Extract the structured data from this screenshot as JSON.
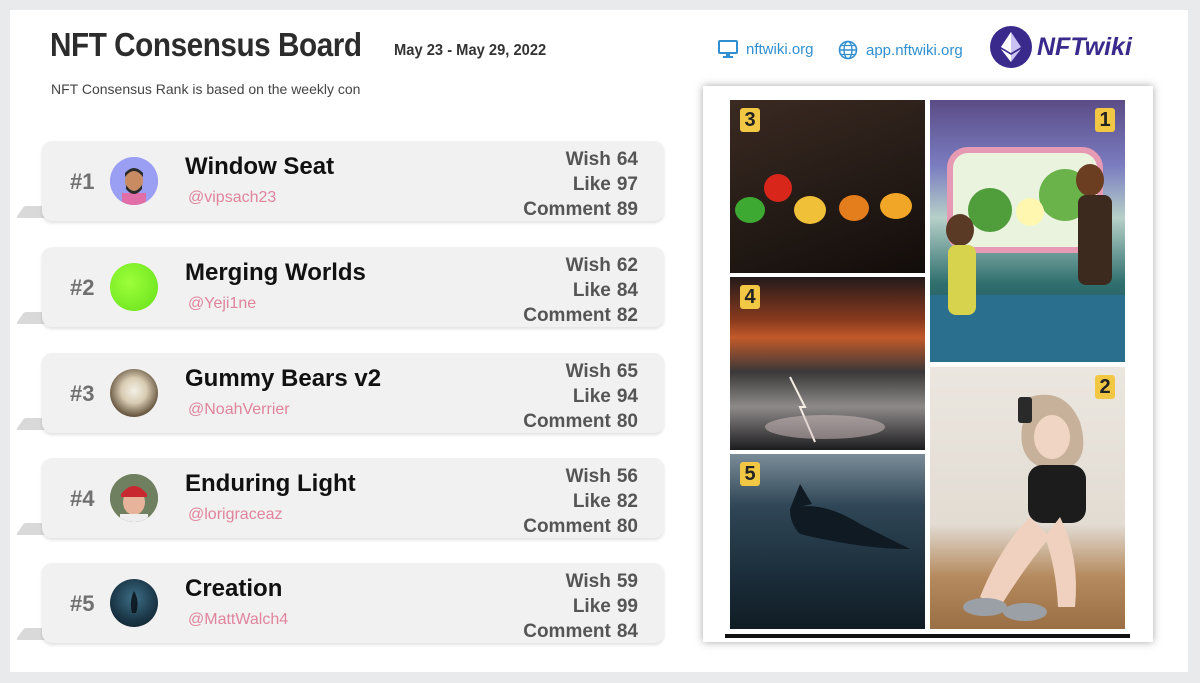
{
  "header": {
    "title": "NFT Consensus Board",
    "date_range": "May 23  - May 29, 2022",
    "subtitle": "NFT Consensus Rank is based on the weekly con",
    "links": [
      {
        "label": "nftwiki.org",
        "icon": "monitor-icon"
      },
      {
        "label": "app.nftwiki.org",
        "icon": "globe-icon"
      }
    ],
    "logo_text": "NFTwiki"
  },
  "labels": {
    "wish": "Wish",
    "like": "Like",
    "comment": "Comment"
  },
  "ranking": [
    {
      "rank": "#1",
      "title": "Window Seat",
      "handle": "@vipsach23",
      "wish": "64",
      "like": "97",
      "comment": "89"
    },
    {
      "rank": "#2",
      "title": "Merging Worlds",
      "handle": "@Yeji1ne",
      "wish": "62",
      "like": "84",
      "comment": "82"
    },
    {
      "rank": "#3",
      "title": "Gummy Bears v2",
      "handle": "@NoahVerrier",
      "wish": "65",
      "like": "94",
      "comment": "80"
    },
    {
      "rank": "#4",
      "title": "Enduring Light",
      "handle": "@lorigraceaz",
      "wish": "56",
      "like": "82",
      "comment": "80"
    },
    {
      "rank": "#5",
      "title": "Creation",
      "handle": "@MattWalch4",
      "wish": "59",
      "like": "99",
      "comment": "84"
    }
  ],
  "gallery": {
    "badges": [
      "3",
      "1",
      "4",
      "2",
      "5"
    ]
  },
  "colors": {
    "link": "#2f8fd0",
    "handle": "#e0849c",
    "brand": "#3a2a8c",
    "badge": "#f2c744"
  }
}
